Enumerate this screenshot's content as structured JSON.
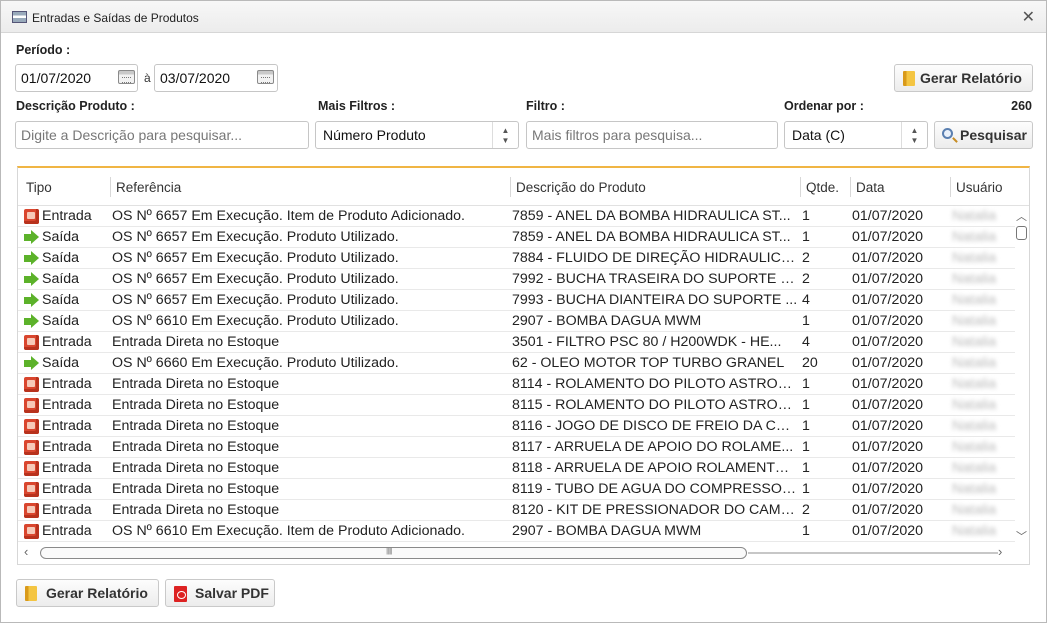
{
  "window": {
    "title": "Entradas e Saídas de Produtos"
  },
  "filters": {
    "period_label": "Período :",
    "date_from": "01/07/2020",
    "date_sep": "à",
    "date_to": "03/07/2020",
    "gen_report_top": "Gerar Relatório",
    "desc_label": "Descrição Produto :",
    "desc_placeholder": "Digite a Descrição para pesquisar...",
    "more_label": "Mais Filtros :",
    "more_value": "Número Produto",
    "filter_label": "Filtro :",
    "filter_placeholder": "Mais filtros para pesquisa...",
    "order_label": "Ordenar por :",
    "order_value": "Data (C)",
    "count": "260",
    "search_label": "Pesquisar"
  },
  "grid": {
    "columns": [
      "Tipo",
      "Referência",
      "Descrição do Produto",
      "Qtde.",
      "Data",
      "Usuário"
    ],
    "rows": [
      {
        "type": "in",
        "tipo": "Entrada",
        "ref": "OS Nº 6657 Em Execução. Item de Produto Adicionado.",
        "desc": "7859 - ANEL DA BOMBA HIDRAULICA ST...",
        "qt": "1",
        "data": "01/07/2020",
        "user": "Natalia"
      },
      {
        "type": "out",
        "tipo": "Saída",
        "ref": "OS Nº 6657 Em Execução. Produto Utilizado.",
        "desc": "7859 - ANEL DA BOMBA HIDRAULICA ST...",
        "qt": "1",
        "data": "01/07/2020",
        "user": "Natalia"
      },
      {
        "type": "out",
        "tipo": "Saída",
        "ref": "OS Nº 6657 Em Execução. Produto Utilizado.",
        "desc": "7884 - FLUIDO DE DIREÇÃO HIDRAULICA ...",
        "qt": "2",
        "data": "01/07/2020",
        "user": "Natalia"
      },
      {
        "type": "out",
        "tipo": "Saída",
        "ref": "OS Nº 6657 Em Execução. Produto Utilizado.",
        "desc": "7992 - BUCHA TRASEIRA DO SUPORTE D...",
        "qt": "2",
        "data": "01/07/2020",
        "user": "Natalia"
      },
      {
        "type": "out",
        "tipo": "Saída",
        "ref": "OS Nº 6657 Em Execução. Produto Utilizado.",
        "desc": "7993 - BUCHA DIANTEIRA DO SUPORTE ...",
        "qt": "4",
        "data": "01/07/2020",
        "user": "Natalia"
      },
      {
        "type": "out",
        "tipo": "Saída",
        "ref": "OS Nº 6610 Em Execução. Produto Utilizado.",
        "desc": "2907 - BOMBA DAGUA MWM",
        "qt": "1",
        "data": "01/07/2020",
        "user": "Natalia"
      },
      {
        "type": "in",
        "tipo": "Entrada",
        "ref": "Entrada Direta no Estoque",
        "desc": "3501 - FILTRO PSC 80  /  H200WDK   -  HE...",
        "qt": "4",
        "data": "01/07/2020",
        "user": "Natalia"
      },
      {
        "type": "out",
        "tipo": "Saída",
        "ref": "OS Nº 6660 Em Execução. Produto Utilizado.",
        "desc": "62 - OLEO MOTOR TOP TURBO GRANEL",
        "qt": "20",
        "data": "01/07/2020",
        "user": "Natalia"
      },
      {
        "type": "in",
        "tipo": "Entrada",
        "ref": "Entrada Direta no Estoque",
        "desc": "8114 - ROLAMENTO DO PILOTO ASTRON...",
        "qt": "1",
        "data": "01/07/2020",
        "user": "Natalia"
      },
      {
        "type": "in",
        "tipo": "Entrada",
        "ref": "Entrada Direta no Estoque",
        "desc": "8115 - ROLAMENTO DO PILOTO ASTRON...",
        "qt": "1",
        "data": "01/07/2020",
        "user": "Natalia"
      },
      {
        "type": "in",
        "tipo": "Entrada",
        "ref": "Entrada Direta no Estoque",
        "desc": "8116 - JOGO DE DISCO DE FREIO DA CAI...",
        "qt": "1",
        "data": "01/07/2020",
        "user": "Natalia"
      },
      {
        "type": "in",
        "tipo": "Entrada",
        "ref": "Entrada Direta no Estoque",
        "desc": "8117 - ARRUELA DE APOIO DO ROLAME...",
        "qt": "1",
        "data": "01/07/2020",
        "user": "Natalia"
      },
      {
        "type": "in",
        "tipo": "Entrada",
        "ref": "Entrada Direta no Estoque",
        "desc": "8118 - ARRUELA DE APOIO ROLAMENTO ...",
        "qt": "1",
        "data": "01/07/2020",
        "user": "Natalia"
      },
      {
        "type": "in",
        "tipo": "Entrada",
        "ref": "Entrada Direta no Estoque",
        "desc": "8119 - TUBO DE AGUA DO COMPRESSOR...",
        "qt": "1",
        "data": "01/07/2020",
        "user": "Natalia"
      },
      {
        "type": "in",
        "tipo": "Entrada",
        "ref": "Entrada Direta no Estoque",
        "desc": "8120 - KIT DE PRESSIONADOR DO CAMBI...",
        "qt": "2",
        "data": "01/07/2020",
        "user": "Natalia"
      },
      {
        "type": "in",
        "tipo": "Entrada",
        "ref": "OS Nº 6610 Em Execução. Item de Produto Adicionado.",
        "desc": "2907 - BOMBA DAGUA MWM",
        "qt": "1",
        "data": "01/07/2020",
        "user": "Natalia"
      }
    ]
  },
  "footer": {
    "gen_report": "Gerar Relatório",
    "save_pdf": "Salvar PDF"
  },
  "colors": {
    "accent": "#f0b544",
    "entrada_icon": "#d9462e",
    "saida_icon": "#5cb22a"
  }
}
